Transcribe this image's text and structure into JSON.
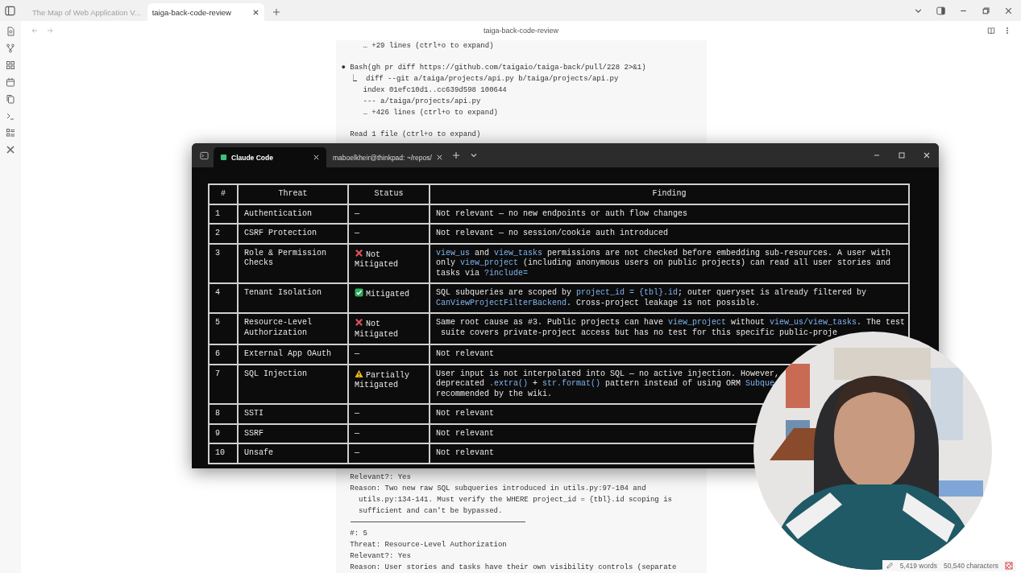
{
  "app_tabs": [
    {
      "label": "The Map of Web Application V...",
      "selected": false
    },
    {
      "label": "taiga-back-code-review",
      "selected": true
    }
  ],
  "note_title": "taiga-back-code-review",
  "document": {
    "top_lines": [
      {
        "kind": "text",
        "text": "     … +29 lines (ctrl+o to expand)"
      },
      {
        "kind": "gap"
      },
      {
        "kind": "text",
        "text": "● Bash(gh pr diff https://github.com/taigaio/taiga-back/pull/228 2>&1)"
      },
      {
        "kind": "text",
        "text": "  ⎿  diff --git a/taiga/projects/api.py b/taiga/projects/api.py"
      },
      {
        "kind": "text",
        "text": "     index 01efc10d1..cc639d598 100644"
      },
      {
        "kind": "text",
        "text": "     --- a/taiga/projects/api.py"
      },
      {
        "kind": "text",
        "text": "     … +426 lines (ctrl+o to expand)"
      },
      {
        "kind": "gap"
      },
      {
        "kind": "text",
        "text": "  Read 1 file (ctrl+o to expand)"
      }
    ],
    "bottom_lines": [
      {
        "kind": "text",
        "text": "  Relevant?: Yes"
      },
      {
        "kind": "text",
        "text": "  Reason: Two new raw SQL subqueries introduced in utils.py:97-104 and"
      },
      {
        "kind": "text",
        "text": "    utils.py:134-141. Must verify the WHERE project_id = {tbl}.id scoping is"
      },
      {
        "kind": "text",
        "text": "    sufficient and can't be bypassed."
      },
      {
        "kind": "rule"
      },
      {
        "kind": "text",
        "text": "  #: 5"
      },
      {
        "kind": "text",
        "text": "  Threat: Resource-Level Authorization"
      },
      {
        "kind": "text",
        "text": "  Relevant?: Yes"
      },
      {
        "kind": "text",
        "text": "  Reason: User stories and tasks have their own visibility controls (separate"
      }
    ]
  },
  "terminal": {
    "tabs": [
      {
        "label": "Claude Code",
        "selected": true
      },
      {
        "label": "maboelkheir@thinkpad: ~/repos/",
        "selected": false
      }
    ],
    "table": {
      "columns": [
        "#",
        "Threat",
        "Status",
        "Finding"
      ],
      "rows": [
        {
          "number": "1",
          "threat": "Authentication",
          "status": {
            "kind": "none",
            "text": "—"
          },
          "finding": [
            [
              {
                "text": "Not relevant — no new endpoints or auth flow changes",
                "code": false
              }
            ]
          ]
        },
        {
          "number": "2",
          "threat": "CSRF Protection",
          "status": {
            "kind": "none",
            "text": "—"
          },
          "finding": [
            [
              {
                "text": "Not relevant — no session/cookie auth introduced",
                "code": false
              }
            ]
          ]
        },
        {
          "number": "3",
          "threat": "Role & Permission Checks",
          "status": {
            "kind": "cross",
            "text": "Not Mitigated"
          },
          "finding": [
            [
              {
                "text": "view_us",
                "code": true
              },
              {
                "text": " and ",
                "code": false
              },
              {
                "text": "view_tasks",
                "code": true
              },
              {
                "text": " permissions are not checked before embedding sub-resources. A user with",
                "code": false
              }
            ],
            [
              {
                "text": "only ",
                "code": false
              },
              {
                "text": "view_project",
                "code": true
              },
              {
                "text": " (including anonymous users on public projects) can read all user stories and",
                "code": false
              }
            ],
            [
              {
                "text": "tasks via ",
                "code": false
              },
              {
                "text": "?include=",
                "code": true
              }
            ]
          ]
        },
        {
          "number": "4",
          "threat": "Tenant Isolation",
          "status": {
            "kind": "check",
            "text": "Mitigated"
          },
          "finding": [
            [
              {
                "text": "SQL subqueries are scoped by ",
                "code": false
              },
              {
                "text": "project_id = {tbl}.id",
                "code": true
              },
              {
                "text": "; outer queryset is already filtered by",
                "code": false
              }
            ],
            [
              {
                "text": "CanViewProjectFilterBackend",
                "code": true
              },
              {
                "text": ". Cross-project leakage is not possible.",
                "code": false
              }
            ]
          ]
        },
        {
          "number": "5",
          "threat": "Resource-Level Authorization",
          "status": {
            "kind": "cross",
            "text": "Not Mitigated"
          },
          "finding": [
            [
              {
                "text": "Same root cause as #3. Public projects can have ",
                "code": false
              },
              {
                "text": "view_project",
                "code": true
              },
              {
                "text": " without ",
                "code": false
              },
              {
                "text": "view_us/view_tasks",
                "code": true
              },
              {
                "text": ". The test",
                "code": false
              }
            ],
            [
              {
                "text": " suite covers private-project access but has no test for this specific public-proje",
                "code": false
              }
            ]
          ]
        },
        {
          "number": "6",
          "threat": "External App OAuth",
          "status": {
            "kind": "none",
            "text": "—"
          },
          "finding": [
            [
              {
                "text": "Not relevant",
                "code": false
              }
            ]
          ]
        },
        {
          "number": "7",
          "threat": "SQL Injection",
          "status": {
            "kind": "warning",
            "text": "Partially Mitigated"
          },
          "finding": [
            [
              {
                "text": "User input is not interpolated into SQL — no active injection. However,",
                "code": false
              }
            ],
            [
              {
                "text": "deprecated ",
                "code": false
              },
              {
                "text": ".extra()",
                "code": true
              },
              {
                "text": " + ",
                "code": false
              },
              {
                "text": "str.format()",
                "code": true
              },
              {
                "text": " pattern instead of using ORM ",
                "code": false
              },
              {
                "text": "Subque",
                "code": true
              }
            ],
            [
              {
                "text": "recommended by the wiki.",
                "code": false
              }
            ]
          ]
        },
        {
          "number": "8",
          "threat": "SSTI",
          "status": {
            "kind": "none",
            "text": "—"
          },
          "finding": [
            [
              {
                "text": "Not relevant",
                "code": false
              }
            ]
          ]
        },
        {
          "number": "9",
          "threat": "SSRF",
          "status": {
            "kind": "none",
            "text": "—"
          },
          "finding": [
            [
              {
                "text": "Not relevant",
                "code": false
              }
            ]
          ]
        },
        {
          "number": "10",
          "threat": "Unsafe",
          "status": {
            "kind": "none",
            "text": "—"
          },
          "finding": [
            [
              {
                "text": "Not relevant",
                "code": false
              }
            ]
          ]
        }
      ]
    }
  },
  "status_bar": {
    "words": "5,419 words",
    "characters": "50,540 characters"
  }
}
